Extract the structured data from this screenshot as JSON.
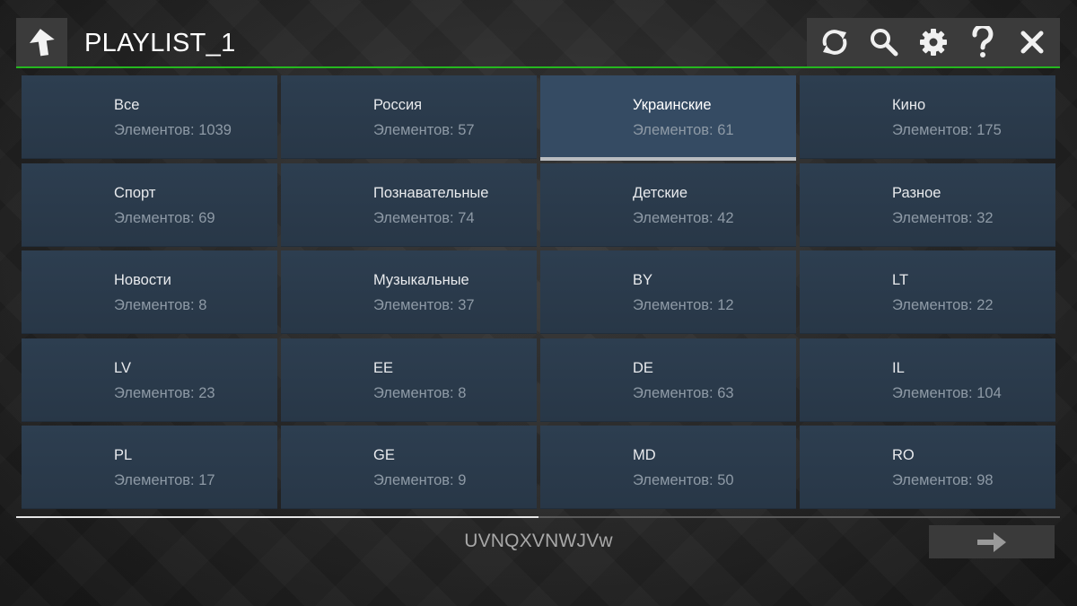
{
  "header": {
    "title": "PLAYLIST_1",
    "back_icon": "arrow-up-icon",
    "toolbar": [
      {
        "name": "refresh-button",
        "icon": "refresh-icon"
      },
      {
        "name": "search-button",
        "icon": "search-icon"
      },
      {
        "name": "settings-button",
        "icon": "gear-icon"
      },
      {
        "name": "help-button",
        "icon": "question-icon"
      },
      {
        "name": "close-button",
        "icon": "close-icon"
      }
    ],
    "accent_color": "#25b81f"
  },
  "grid": {
    "selected_index": 2,
    "tiles": [
      {
        "name": "Все",
        "count": "Элементов: 1039"
      },
      {
        "name": "Россия",
        "count": "Элементов: 57"
      },
      {
        "name": "Украинские",
        "count": "Элементов: 61"
      },
      {
        "name": "Кино",
        "count": "Элементов: 175"
      },
      {
        "name": "Спорт",
        "count": "Элементов: 69"
      },
      {
        "name": "Познавательные",
        "count": "Элементов: 74"
      },
      {
        "name": "Детские",
        "count": "Элементов: 42"
      },
      {
        "name": "Разное",
        "count": "Элементов: 32"
      },
      {
        "name": "Новости",
        "count": "Элементов: 8"
      },
      {
        "name": "Музыкальные",
        "count": "Элементов: 37"
      },
      {
        "name": "BY",
        "count": "Элементов: 12"
      },
      {
        "name": "LT",
        "count": "Элементов: 22"
      },
      {
        "name": "LV",
        "count": "Элементов: 23"
      },
      {
        "name": "EE",
        "count": "Элементов: 8"
      },
      {
        "name": "DE",
        "count": "Элементов: 63"
      },
      {
        "name": "IL",
        "count": "Элементов: 104"
      },
      {
        "name": "PL",
        "count": "Элементов: 17"
      },
      {
        "name": "GE",
        "count": "Элементов: 9"
      },
      {
        "name": "MD",
        "count": "Элементов: 50"
      },
      {
        "name": "RO",
        "count": "Элементов: 98"
      }
    ]
  },
  "footer": {
    "code": "UVNQXVNWJVw",
    "scroll_progress": 0.5,
    "next_icon": "arrow-right-icon"
  }
}
